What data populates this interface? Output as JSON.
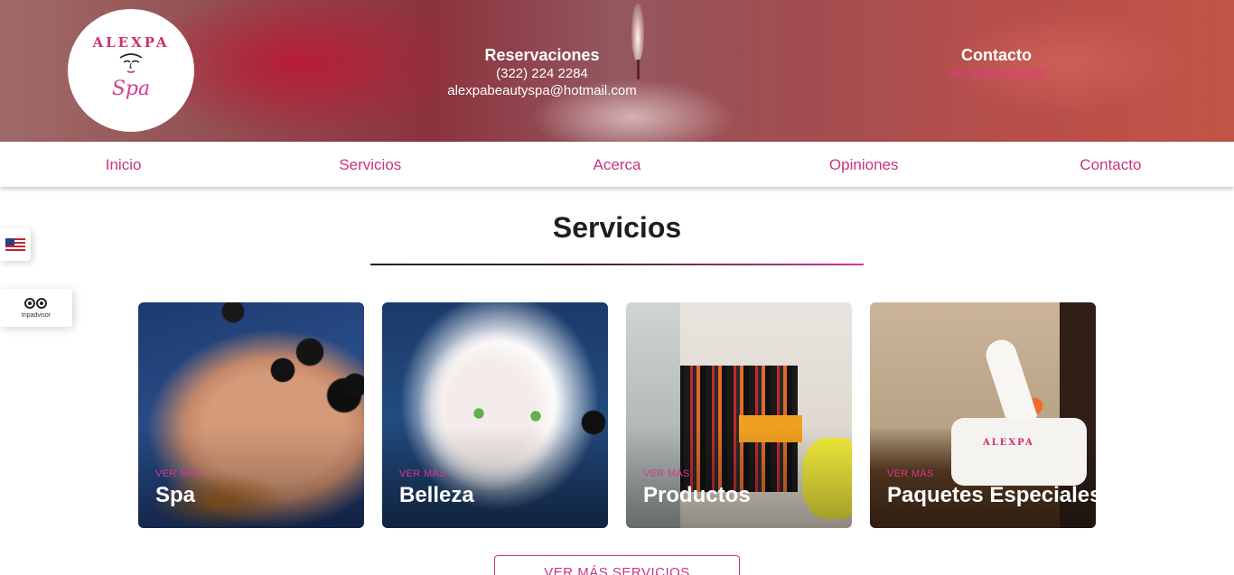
{
  "header": {
    "logo": {
      "brand": "ALEXPA",
      "sub": "Spa"
    },
    "reservations": {
      "title": "Reservaciones",
      "phone": "(322) 224 2284",
      "email": "alexpabeautyspa@hotmail.com"
    },
    "contact": {
      "title": "Contacto",
      "link": "Ver Ubicaciones"
    }
  },
  "nav": [
    "Inicio",
    "Servicios",
    "Acerca",
    "Opiniones",
    "Contacto"
  ],
  "side": {
    "tripadvisor": "tripadvisor"
  },
  "section": {
    "title": "Servicios"
  },
  "cards": [
    {
      "more": "VER MÁS",
      "title": "Spa"
    },
    {
      "more": "VER MÁS",
      "title": "Belleza"
    },
    {
      "more": "VER MÁS",
      "title": "Productos"
    },
    {
      "more": "VER MÁS",
      "title": "Paquetes Especiales"
    }
  ],
  "more_button": "VER MÁS SERVICIOS",
  "colors": {
    "accent": "#c8347e",
    "link": "#e8368a"
  }
}
